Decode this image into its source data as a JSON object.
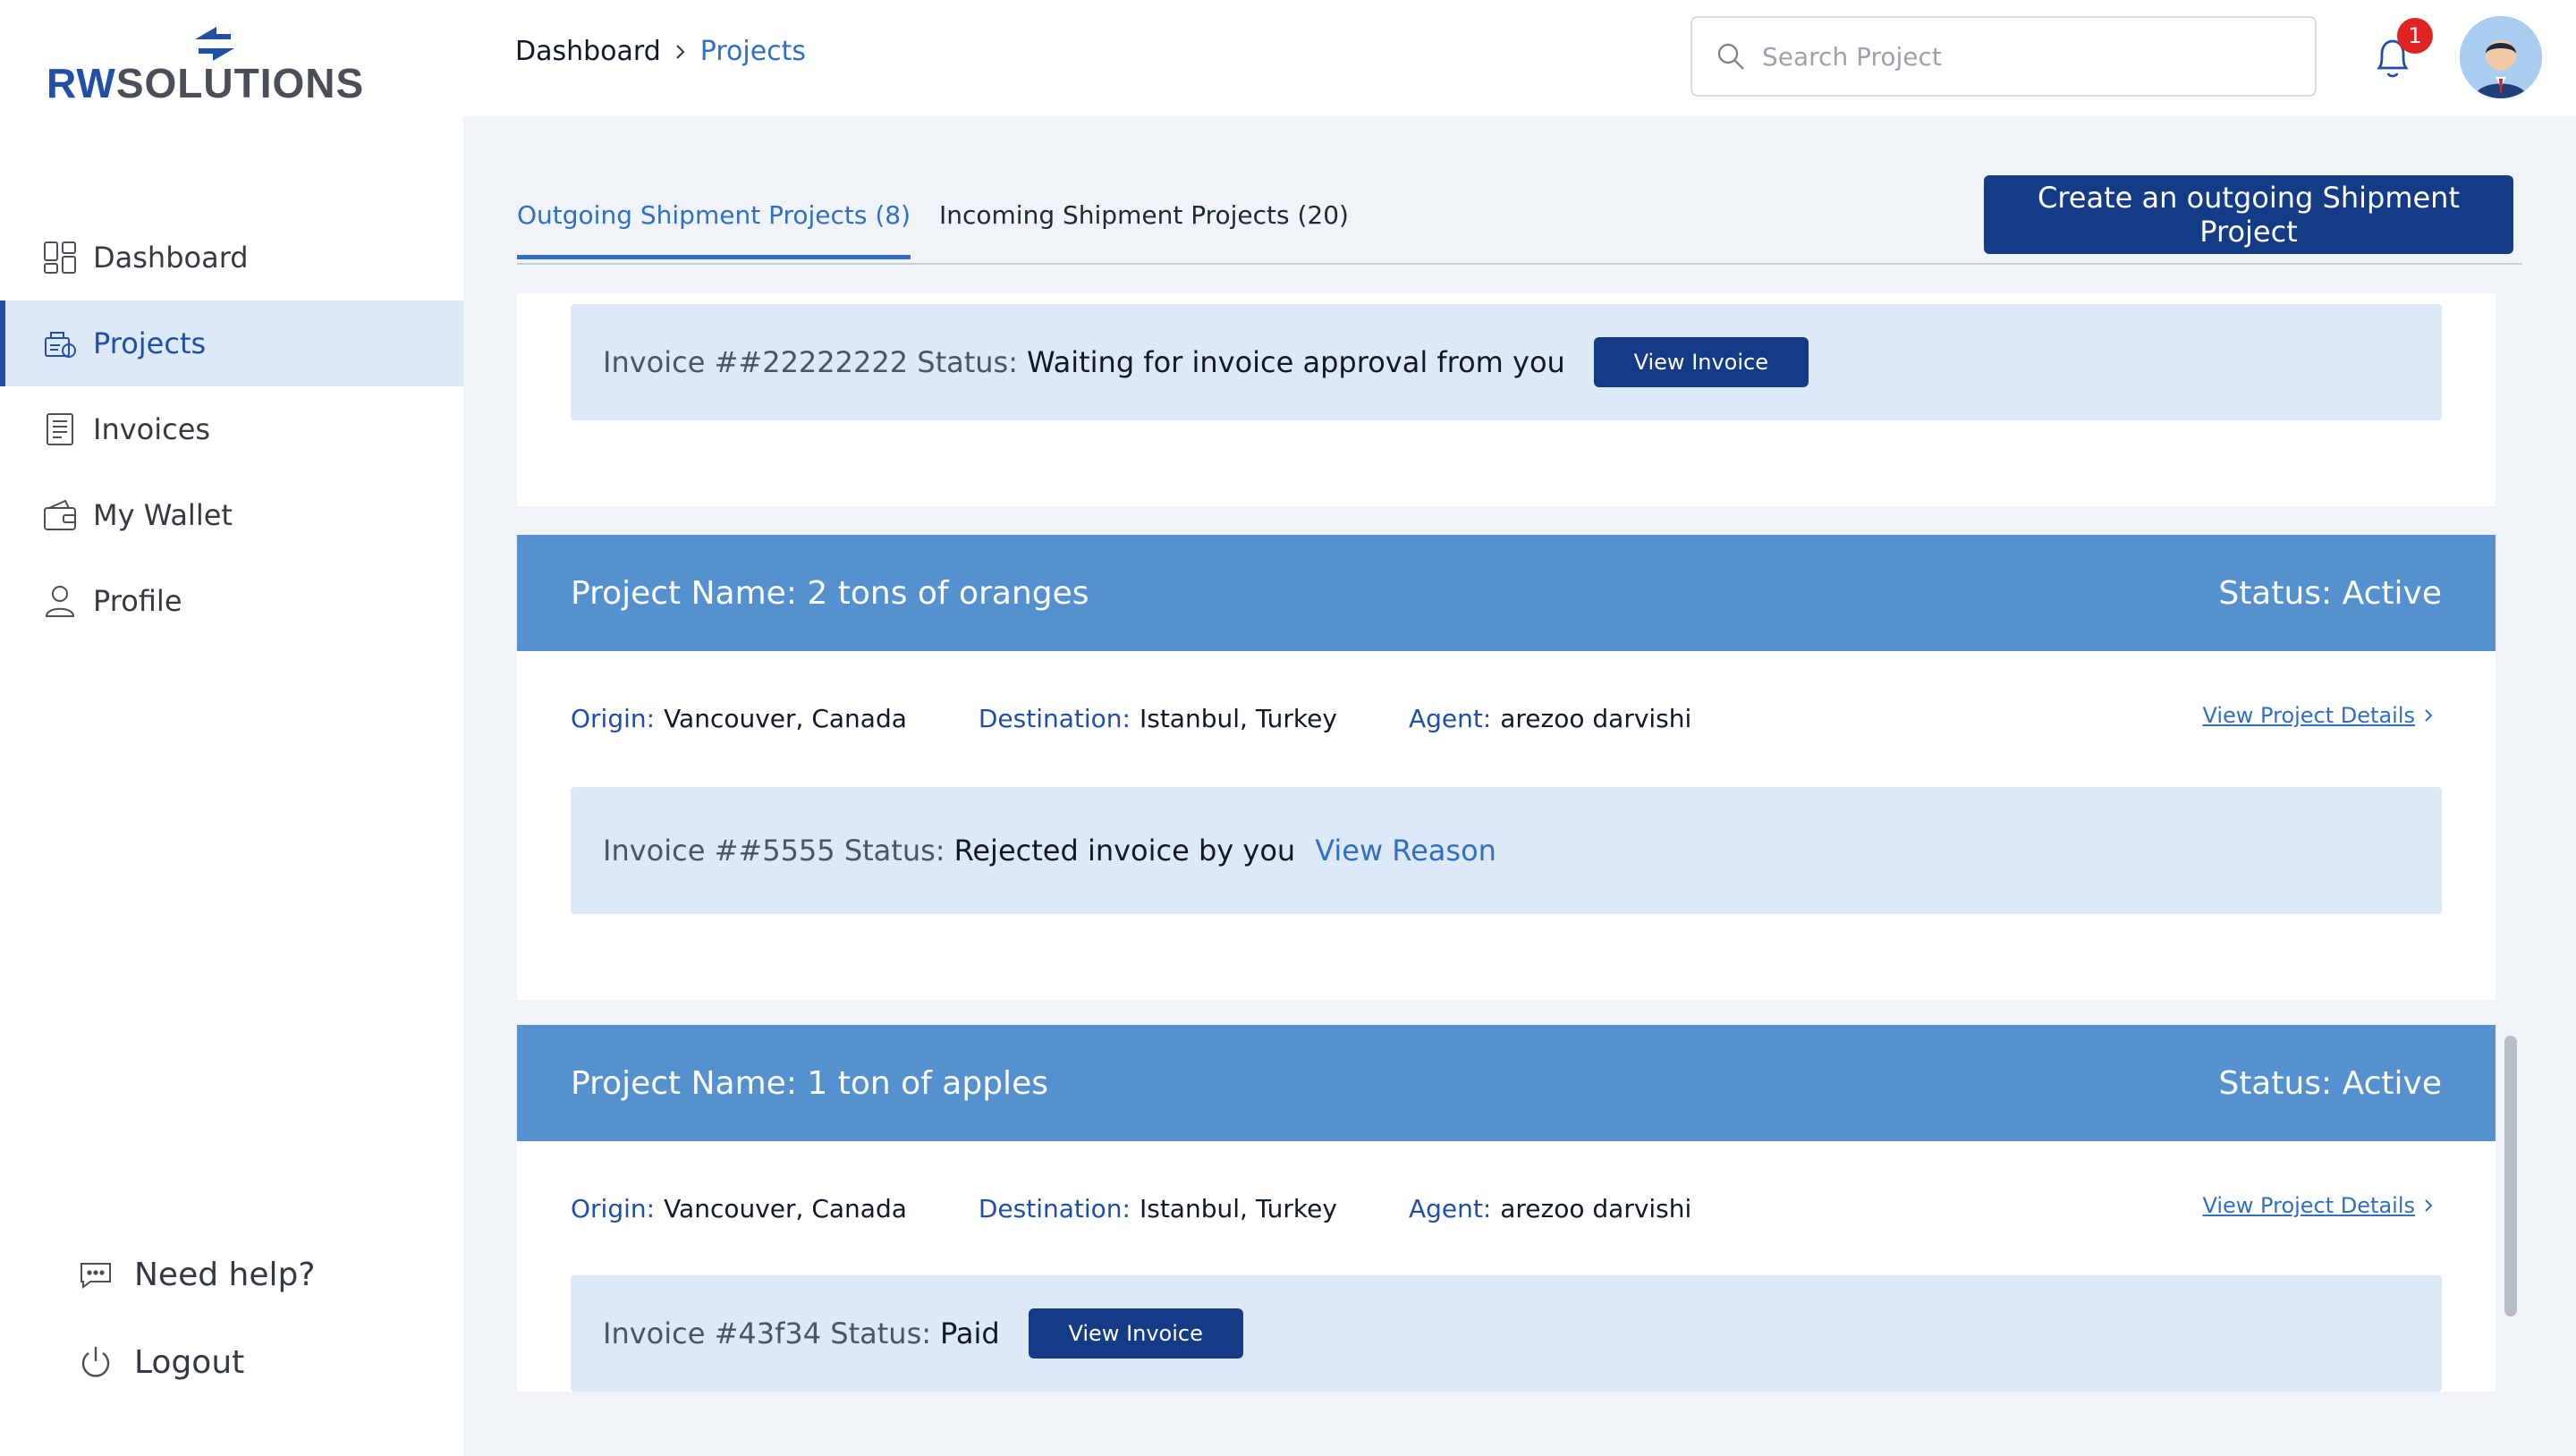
{
  "brand": {
    "name_accent": "RW",
    "name_rest": "SOLUTIONS",
    "colors": {
      "primary": "#143b85",
      "accent": "#5590cf",
      "link": "#2f6fc4",
      "badge": "#e02424"
    }
  },
  "sidebar": {
    "items": [
      {
        "label": "Dashboard",
        "icon": "dashboard-icon",
        "active": false
      },
      {
        "label": "Projects",
        "icon": "projects-icon",
        "active": true
      },
      {
        "label": "Invoices",
        "icon": "invoice-icon",
        "active": false
      },
      {
        "label": "My Wallet",
        "icon": "wallet-icon",
        "active": false
      },
      {
        "label": "Profile",
        "icon": "user-icon",
        "active": false
      }
    ],
    "bottom": [
      {
        "label": "Need help?",
        "icon": "chat-icon"
      },
      {
        "label": "Logout",
        "icon": "power-icon"
      }
    ]
  },
  "header": {
    "breadcrumb": {
      "root": "Dashboard",
      "current": "Projects"
    },
    "search_placeholder": "Search Project",
    "notifications_count": "1"
  },
  "tabs": {
    "outgoing": "Outgoing Shipment Projects (8)",
    "incoming": "Incoming Shipment Projects (20)",
    "create_button": "Create an outgoing Shipment Project"
  },
  "cards": [
    {
      "invoice_label": "Invoice ##22222222 Status:",
      "invoice_status": "Waiting for invoice approval from you",
      "invoice_action": "View Invoice"
    },
    {
      "project_label": "Project Name:",
      "project_name": "2 tons of oranges",
      "status": "Status: Active",
      "origin_label": "Origin:",
      "origin": "Vancouver, Canada",
      "destination_label": "Destination:",
      "destination": "Istanbul, Turkey",
      "agent_label": "Agent:",
      "agent": "arezoo darvishi",
      "details_link": "View Project Details",
      "invoice_label": "Invoice ##5555 Status:",
      "invoice_status": "Rejected invoice by you",
      "invoice_action": "View Reason"
    },
    {
      "project_label": "Project Name:",
      "project_name": "1 ton of apples",
      "status": "Status: Active",
      "origin_label": "Origin:",
      "origin": "Vancouver, Canada",
      "destination_label": "Destination:",
      "destination": "Istanbul, Turkey",
      "agent_label": "Agent:",
      "agent": "arezoo darvishi",
      "details_link": "View Project Details",
      "invoice_label": "Invoice #43f34 Status:",
      "invoice_status": "Paid",
      "invoice_action": "View Invoice"
    }
  ]
}
